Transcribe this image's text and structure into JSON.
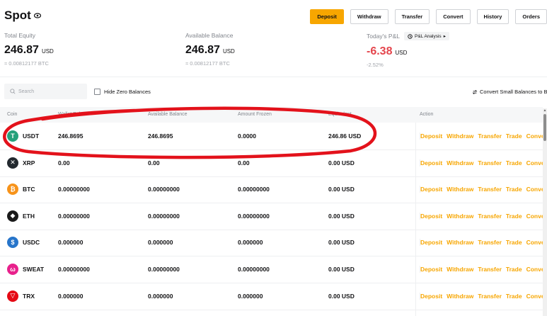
{
  "header": {
    "title": "Spot",
    "buttons": [
      "Deposit",
      "Withdraw",
      "Transfer",
      "Convert",
      "History",
      "Orders"
    ]
  },
  "stats": {
    "total_equity": {
      "label": "Total Equity",
      "value": "246.87",
      "currency": "USD",
      "sub": "≈ 0.00812177 BTC"
    },
    "available_balance": {
      "label": "Available Balance",
      "value": "246.87",
      "currency": "USD",
      "sub": "≈ 0.00812177 BTC"
    },
    "pnl": {
      "label": "Today's P&L",
      "chip": "P&L Analysis",
      "value": "-6.38",
      "currency": "USD",
      "percent": "-2.52%"
    }
  },
  "toolbar": {
    "search_placeholder": "Search",
    "hide_zero": "Hide Zero Balances",
    "convert_small": "Convert Small Balances to BIT"
  },
  "table": {
    "columns": [
      "Coin",
      "Wallet Bal",
      "Available Balance",
      "Amount Frozen",
      "Equivalent",
      "Action"
    ],
    "actions": [
      "Deposit",
      "Withdraw",
      "Transfer",
      "Trade",
      "Convert"
    ],
    "rows": [
      {
        "coin": "USDT",
        "icon": "tether-icon",
        "color": "#26a17b",
        "glyph": "T",
        "wallet": "246.8695",
        "available": "246.8695",
        "frozen": "0.0000",
        "equivalent": "246.86 USD"
      },
      {
        "coin": "XRP",
        "icon": "xrp-icon",
        "color": "#23292f",
        "glyph": "✕",
        "wallet": "0.00",
        "available": "0.00",
        "frozen": "0.00",
        "equivalent": "0.00 USD"
      },
      {
        "coin": "BTC",
        "icon": "bitcoin-icon",
        "color": "#f7931a",
        "glyph": "₿",
        "wallet": "0.00000000",
        "available": "0.00000000",
        "frozen": "0.00000000",
        "equivalent": "0.00 USD"
      },
      {
        "coin": "ETH",
        "icon": "ethereum-icon",
        "color": "#1a1a1a",
        "glyph": "◆",
        "wallet": "0.00000000",
        "available": "0.00000000",
        "frozen": "0.00000000",
        "equivalent": "0.00 USD"
      },
      {
        "coin": "USDC",
        "icon": "usdc-icon",
        "color": "#2775ca",
        "glyph": "$",
        "wallet": "0.000000",
        "available": "0.000000",
        "frozen": "0.000000",
        "equivalent": "0.00 USD"
      },
      {
        "coin": "SWEAT",
        "icon": "sweat-icon",
        "color": "#e8218c",
        "glyph": "ω",
        "wallet": "0.00000000",
        "available": "0.00000000",
        "frozen": "0.00000000",
        "equivalent": "0.00 USD"
      },
      {
        "coin": "TRX",
        "icon": "tron-icon",
        "color": "#e50914",
        "glyph": "▽",
        "wallet": "0.000000",
        "available": "0.000000",
        "frozen": "0.000000",
        "equivalent": "0.00 USD"
      }
    ]
  }
}
